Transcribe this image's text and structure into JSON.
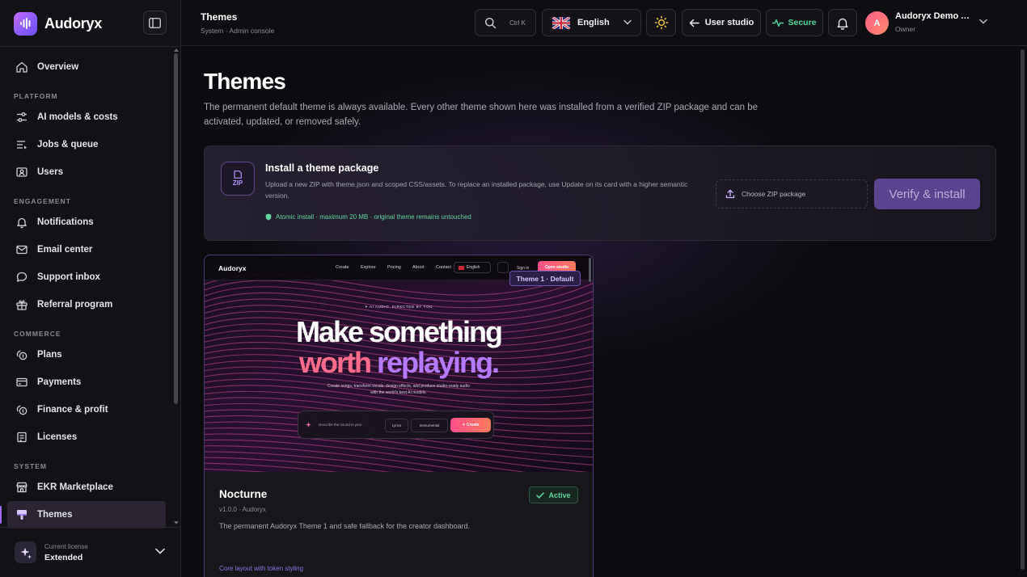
{
  "app": {
    "name": "Audoryx"
  },
  "sidebar": {
    "overview": "Overview",
    "sections": [
      {
        "title": "PLATFORM",
        "items": [
          {
            "label": "AI models & costs",
            "icon": "sliders-icon"
          },
          {
            "label": "Jobs & queue",
            "icon": "queue-icon"
          },
          {
            "label": "Users",
            "icon": "users-icon"
          }
        ]
      },
      {
        "title": "ENGAGEMENT",
        "items": [
          {
            "label": "Notifications",
            "icon": "bell-icon"
          },
          {
            "label": "Email center",
            "icon": "mail-icon"
          },
          {
            "label": "Support inbox",
            "icon": "chat-icon"
          },
          {
            "label": "Referral program",
            "icon": "gift-icon"
          }
        ]
      },
      {
        "title": "COMMERCE",
        "items": [
          {
            "label": "Plans",
            "icon": "coins-icon"
          },
          {
            "label": "Payments",
            "icon": "card-icon"
          },
          {
            "label": "Finance & profit",
            "icon": "coins-icon"
          },
          {
            "label": "Licenses",
            "icon": "license-icon"
          }
        ]
      },
      {
        "title": "SYSTEM",
        "items": [
          {
            "label": "EKR Marketplace",
            "icon": "store-icon"
          },
          {
            "label": "Themes",
            "icon": "brush-icon",
            "active": true
          }
        ]
      }
    ],
    "license": {
      "caption": "Current license",
      "value": "Extended"
    }
  },
  "topbar": {
    "title": "Themes",
    "subtitle": "System · Admin console",
    "search_shortcut": "Ctrl K",
    "language": "English",
    "user_studio": "User studio",
    "secure": "Secure",
    "user": {
      "initial": "A",
      "name": "Audoryx Demo Admin",
      "role": "Owner"
    }
  },
  "page": {
    "title": "Themes",
    "description": "The permanent default theme is always available. Every other theme shown here was installed from a verified ZIP package and can be activated, updated, or removed safely."
  },
  "install": {
    "icon_label": "ZIP",
    "title": "Install a theme package",
    "description": "Upload a new ZIP with theme.json and scoped CSS/assets. To replace an installed package, use Update on its card with a higher semantic version.",
    "note": "Atomic install · maximum 20 MB · original theme remains untouched",
    "choose_label": "Choose ZIP package",
    "verify_label": "Verify & install"
  },
  "theme_card": {
    "preview": {
      "brand": "Audoryx",
      "nav_links": [
        "Create",
        "Explore",
        "Pricing",
        "About",
        "Contact"
      ],
      "language": "English",
      "sign_in": "Sign in",
      "open_studio": "Open studio",
      "badge": "Theme 1 · Default",
      "kicker": "✦ AI AUDIO, DIRECTED BY YOU",
      "headline_1": "Make something",
      "headline_2a": "worth ",
      "headline_2b": "replaying.",
      "sub": "Create songs, transform vocals, design effects, and produce studio-ready audio with the world's best AI models.",
      "prompt_placeholder": "Describe the sound in your",
      "chip_lyrics": "Lyrics",
      "chip_instrumental": "Instrumental",
      "create": "✦ Create"
    },
    "name": "Nocturne",
    "version": "v1.0.0 · Audoryx",
    "status": "Active",
    "description": "The permanent Audoryx Theme 1 and safe fallback for the creator dashboard.",
    "footer": "Core layout with token styling"
  }
}
